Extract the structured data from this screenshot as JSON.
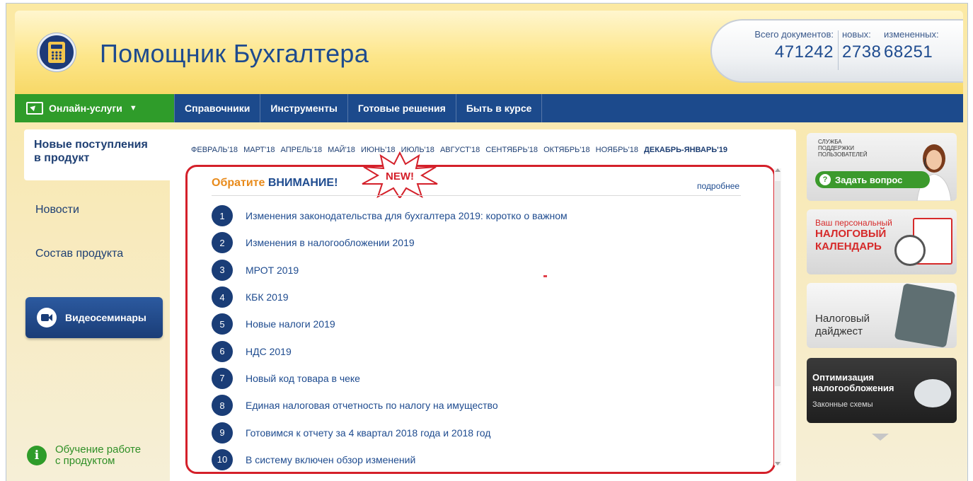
{
  "header": {
    "title": "Помощник Бухгалтера",
    "stats": {
      "total_label": "Всего документов:",
      "total_value": "471242",
      "new_label": "новых:",
      "new_value": "2738",
      "changed_label": "измененных:",
      "changed_value": "68251"
    }
  },
  "nav": {
    "online": "Онлайн-услуги",
    "items": [
      "Справочники",
      "Инструменты",
      "Готовые решения",
      "Быть в курсе"
    ]
  },
  "sidebar": {
    "active_line1": "Новые поступления",
    "active_line2": "в продукт",
    "news": "Новости",
    "composition": "Состав продукта",
    "video": "Видеосеминары",
    "training_line1": "Обучение работе",
    "training_line2": "с продуктом"
  },
  "months": [
    "ФЕВРАЛЬ'18",
    "МАРТ'18",
    "АПРЕЛЬ'18",
    "МАЙ'18",
    "ИЮНЬ'18",
    "ИЮЛЬ'18",
    "АВГУСТ'18",
    "СЕНТЯБРЬ'18",
    "ОКТЯБРЬ'18",
    "НОЯБРЬ'18",
    "ДЕКАБРЬ-ЯНВАРЬ'19"
  ],
  "news_box": {
    "heading_orange": "Обратите",
    "heading_blue": "ВНИМАНИЕ!",
    "badge": "NEW!",
    "more": "подробнее",
    "items": [
      {
        "num": "1",
        "text": "Изменения законодательства для бухгалтера 2019: коротко о важном"
      },
      {
        "num": "2",
        "text": "Изменения в налогообложении 2019"
      },
      {
        "num": "3",
        "text": "МРОТ 2019"
      },
      {
        "num": "4",
        "text": "КБК 2019"
      },
      {
        "num": "5",
        "text": "Новые налоги 2019"
      },
      {
        "num": "6",
        "text": "НДС 2019"
      },
      {
        "num": "7",
        "text": "Новый код товара в чеке"
      },
      {
        "num": "8",
        "text": "Единая налоговая отчетность по налогу на имущество"
      },
      {
        "num": "9",
        "text": "Готовимся к отчету за 4 квартал 2018 года и 2018 год"
      },
      {
        "num": "10",
        "text": "В систему включен обзор изменений"
      }
    ]
  },
  "banners": {
    "support_l1": "СЛУЖБА",
    "support_l2": "ПОДДЕРЖКИ",
    "support_l3": "ПОЛЬЗОВАТЕЛЕЙ",
    "ask": "Задать вопрос",
    "calendar_l1": "Ваш персональный",
    "calendar_l2": "НАЛОГОВЫЙ",
    "calendar_l3": "КАЛЕНДАРЬ",
    "digest_l1": "Налоговый",
    "digest_l2": "дайджест",
    "optim_l1": "Оптимизация",
    "optim_l2": "налогообложения",
    "optim_l3": "Законные схемы"
  }
}
